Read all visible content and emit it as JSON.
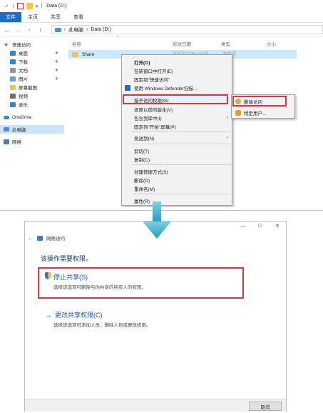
{
  "explorer": {
    "window_title": "Data (D:)",
    "ribbon_tabs": [
      "文件",
      "主页",
      "共享",
      "查看"
    ],
    "address": {
      "back": "←",
      "forward": "→",
      "up": "↑",
      "path": [
        "此电脑",
        "Data (D:)"
      ],
      "separator": "›"
    },
    "nav_pane": {
      "quick_access": "快速访问",
      "items": [
        "桌面",
        "下载",
        "文档",
        "图片",
        "屏幕截图",
        "视频",
        "音乐"
      ],
      "onedrive": "OneDrive",
      "this_pc": "此电脑",
      "network": "网络"
    },
    "columns": {
      "name": "名称",
      "date": "修改日期",
      "type": "类型",
      "size": "大小"
    },
    "file": {
      "name": "Share",
      "date": "2017/11/30 15:05",
      "type": "文件夹"
    },
    "context_menu": {
      "items": [
        "打开(O)",
        "在新窗口中打开(E)",
        "固定到\"快速访问\"",
        "使用 Windows Defender扫描...",
        "授予访问权限(G)",
        "还原以前的版本(V)",
        "包含到库中(I)",
        "固定到\"开始\"屏幕(P)",
        "发送到(N)",
        "剪切(T)",
        "复制(C)",
        "创建快捷方式(S)",
        "删除(D)",
        "重命名(M)",
        "属性(R)"
      ],
      "submenu_arrow": "›"
    },
    "submenu": {
      "items": [
        "删除访问",
        "特定用户..."
      ]
    }
  },
  "dialog": {
    "controls": {
      "minimize": "—",
      "maximize": "☐",
      "close": "✕"
    },
    "back": "←",
    "title": "网络访问",
    "heading": "该操作需要权限。",
    "option1": {
      "title": "停止共享(S)",
      "desc": "选择该选项可删除与你共享的所有人的权限。"
    },
    "option2": {
      "title": "更改共享权限(C)",
      "desc": "选择该选项可添加人员，删除人员或更改权限。"
    },
    "cancel": "取消"
  },
  "colors": {
    "accent": "#1a6fc4",
    "highlight_red": "#d9363e",
    "arrow_teal": "#2aa6c4"
  }
}
